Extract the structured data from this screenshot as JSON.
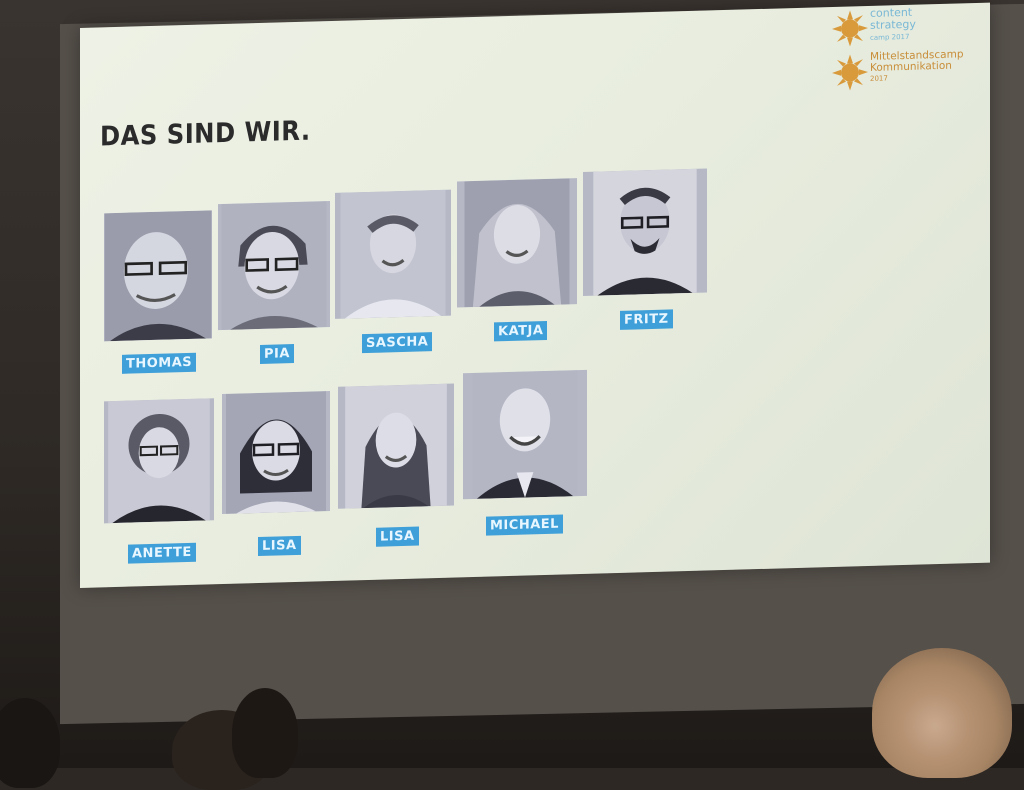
{
  "slide": {
    "title": "DAS SIND WIR."
  },
  "logos": {
    "content_strategy": {
      "line1": "content",
      "line2": "strategy",
      "line3": "camp 2017",
      "color": "#7ab8d6"
    },
    "mittelstandscamp": {
      "line1": "Mittelstandscamp",
      "line2": "Kommunikation",
      "line3": "2017",
      "color": "#c98e3a"
    }
  },
  "team": [
    {
      "name": "THOMAS"
    },
    {
      "name": "PIA"
    },
    {
      "name": "SASCHA"
    },
    {
      "name": "KATJA"
    },
    {
      "name": "FRITZ"
    },
    {
      "name": "ANETTE"
    },
    {
      "name": "LISA"
    },
    {
      "name": "LISA"
    },
    {
      "name": "MICHAEL"
    }
  ],
  "colors": {
    "label_bg": "#3f9fd8",
    "label_text": "#e8f6ff",
    "title_text": "#2b2b2b"
  }
}
